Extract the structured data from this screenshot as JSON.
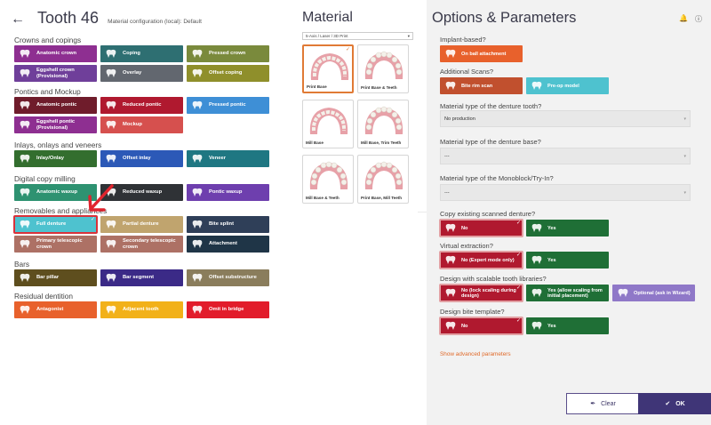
{
  "header": {
    "title": "Tooth 46",
    "subtitle": "Material configuration (local): Default"
  },
  "sections": [
    {
      "title": "Crowns and copings",
      "rows": [
        [
          {
            "label": "Anatomic crown",
            "color": "#8e2f91",
            "icon": "crown-icon"
          },
          {
            "label": "Coping",
            "color": "#2e6f72",
            "icon": "coping-icon"
          },
          {
            "label": "Pressed crown",
            "color": "#7a8a3c",
            "icon": "pressed-crown-icon"
          }
        ],
        [
          {
            "label": "Eggshell crown (Provisional)",
            "color": "#6f3f9a",
            "icon": "eggshell-crown-icon"
          },
          {
            "label": "Overlay",
            "color": "#62676f",
            "icon": "overlay-icon"
          },
          {
            "label": "Offset coping",
            "color": "#8f8f2b",
            "icon": "offset-coping-icon"
          }
        ]
      ]
    },
    {
      "title": "Pontics and Mockup",
      "rows": [
        [
          {
            "label": "Anatomic pontic",
            "color": "#6f1c2b",
            "icon": "pontic-icon"
          },
          {
            "label": "Reduced pontic",
            "color": "#b0192f",
            "icon": "reduced-pontic-icon"
          },
          {
            "label": "Pressed pontic",
            "color": "#3e8fd6",
            "icon": "pressed-pontic-icon"
          }
        ],
        [
          {
            "label": "Eggshell pontic (Provisional)",
            "color": "#8e2f91",
            "icon": "eggshell-pontic-icon"
          },
          {
            "label": "Mockup",
            "color": "#d6504e",
            "icon": "mockup-icon"
          }
        ]
      ]
    },
    {
      "title": "Inlays, onlays and veneers",
      "rows": [
        [
          {
            "label": "Inlay/Onlay",
            "color": "#336e2e",
            "icon": "inlay-icon"
          },
          {
            "label": "Offset inlay",
            "color": "#2c59b7",
            "icon": "offset-inlay-icon"
          },
          {
            "label": "Veneer",
            "color": "#1f7782",
            "icon": "veneer-icon"
          }
        ]
      ]
    },
    {
      "title": "Digital copy milling",
      "rows": [
        [
          {
            "label": "Anatomic waxup",
            "color": "#2e9271",
            "icon": "waxup-icon"
          },
          {
            "label": "Reduced waxup",
            "color": "#2f3236",
            "icon": "reduced-waxup-icon"
          },
          {
            "label": "Pontic waxup",
            "color": "#6e3fae",
            "icon": "pontic-waxup-icon"
          }
        ]
      ]
    },
    {
      "title": "Removables and appliances",
      "rows": [
        [
          {
            "label": "Full denture",
            "color": "#4ec2cf",
            "icon": "full-denture-icon",
            "selected": true
          },
          {
            "label": "Partial denture",
            "color": "#c0a46e",
            "icon": "partial-denture-icon"
          },
          {
            "label": "Bite splint",
            "color": "#2f3f58",
            "icon": "bite-splint-icon"
          }
        ],
        [
          {
            "label": "Primary telescopic crown",
            "color": "#ad7165",
            "icon": "primary-telescopic-icon"
          },
          {
            "label": "Secondary telescopic crown",
            "color": "#ad7165",
            "icon": "secondary-telescopic-icon"
          },
          {
            "label": "Attachment",
            "color": "#1f3547",
            "icon": "attachment-icon"
          }
        ]
      ]
    },
    {
      "title": "Bars",
      "rows": [
        [
          {
            "label": "Bar pillar",
            "color": "#5e4e1e",
            "icon": "bar-pillar-icon"
          },
          {
            "label": "Bar segment",
            "color": "#3b2a87",
            "icon": "bar-segment-icon"
          },
          {
            "label": "Offset substructure",
            "color": "#8a7d5c",
            "icon": "offset-substructure-icon"
          }
        ]
      ]
    },
    {
      "title": "Residual dentition",
      "rows": [
        [
          {
            "label": "Antagonist",
            "color": "#e8612c",
            "icon": "antagonist-icon"
          },
          {
            "label": "Adjacent tooth",
            "color": "#f2b119",
            "icon": "adjacent-tooth-icon"
          },
          {
            "label": "Omit in bridge",
            "color": "#e21c2b",
            "icon": "omit-icon"
          }
        ]
      ]
    }
  ],
  "material": {
    "title": "Material",
    "select_value": "5-Axis / Laser / 3D Print",
    "cards": [
      {
        "label": "Print Base",
        "selected": true
      },
      {
        "label": "Print Base & Teeth"
      },
      {
        "label": "Mill Base"
      },
      {
        "label": "Mill Base, Trim Teeth"
      },
      {
        "label": "Mill Base & Teeth"
      },
      {
        "label": "Print Base, Mill Teeth"
      }
    ]
  },
  "options": {
    "title": "Options & Parameters",
    "implant": {
      "question": "Implant-based?",
      "options": [
        {
          "label": "On ball attachment",
          "color": "#e8612c"
        }
      ]
    },
    "scans": {
      "question": "Additional Scans?",
      "options": [
        {
          "label": "Bite rim scan",
          "color": "#c1502e"
        },
        {
          "label": "Pre-op model",
          "color": "#4ec2cf"
        }
      ]
    },
    "tooth_material": {
      "question": "Material type of the denture tooth?",
      "value": "No production"
    },
    "base_material": {
      "question": "Material type of the denture base?",
      "value": "---"
    },
    "monoblock_material": {
      "question": "Material type of the Monoblock/Try-In?",
      "value": "---"
    },
    "copy_denture": {
      "question": "Copy existing scanned denture?",
      "options": [
        {
          "label": "No",
          "color": "#b0192f",
          "selected": true
        },
        {
          "label": "Yes",
          "color": "#1f6f36"
        }
      ]
    },
    "virtual_extraction": {
      "question": "Virtual extraction?",
      "options": [
        {
          "label": "No (Expert mode only)",
          "color": "#b0192f",
          "selected": true
        },
        {
          "label": "Yes",
          "color": "#1f6f36"
        }
      ]
    },
    "scalable_libraries": {
      "question": "Design with scalable tooth libraries?",
      "options": [
        {
          "label": "No (lock scaling during design)",
          "color": "#b0192f",
          "selected": true
        },
        {
          "label": "Yes (allow scaling from initial placement)",
          "color": "#1f6f36"
        },
        {
          "label": "Optional (ask in Wizard)",
          "color": "#8f78c8"
        }
      ]
    },
    "bite_template": {
      "question": "Design bite template?",
      "options": [
        {
          "label": "No",
          "color": "#b0192f",
          "selected": true
        },
        {
          "label": "Yes",
          "color": "#1f6f36"
        }
      ]
    },
    "advanced_link": "Show advanced parameters"
  },
  "buttons": {
    "clear": "Clear",
    "ok": "OK"
  }
}
